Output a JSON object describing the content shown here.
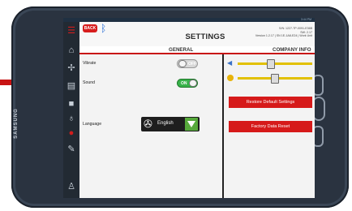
{
  "device": {
    "brand": "SAMSUNG"
  },
  "statusbar": {
    "text": "3:44 PM"
  },
  "header": {
    "back_label": "BACK",
    "title": "SETTINGS",
    "info": [
      "S/N: 1227-TP-0091-E36B",
      "SW: 2.17",
      "Version 1.2.17 | SN 1E-1A8-E24 | Work Unit"
    ]
  },
  "tabs": [
    {
      "label": "GENERAL",
      "active": true
    },
    {
      "label": "COMPANY INFO",
      "active": false
    }
  ],
  "settings": {
    "vibrate": {
      "label": "Vibrate",
      "state": "OFF"
    },
    "sound": {
      "label": "Sound",
      "state": "ON"
    },
    "language": {
      "label": "Language",
      "value": "English"
    }
  },
  "sliders": {
    "volume": {
      "icon": "volume-icon",
      "level": 0.45
    },
    "brightness": {
      "icon": "brightness-icon",
      "level": 0.5
    }
  },
  "buttons": {
    "restore": "Restore Default Settings",
    "factory": "Factory Data Reset"
  },
  "colors": {
    "accent": "#d61a1a",
    "toggle_on": "#38b24a",
    "slider_track": "#e2c000"
  }
}
